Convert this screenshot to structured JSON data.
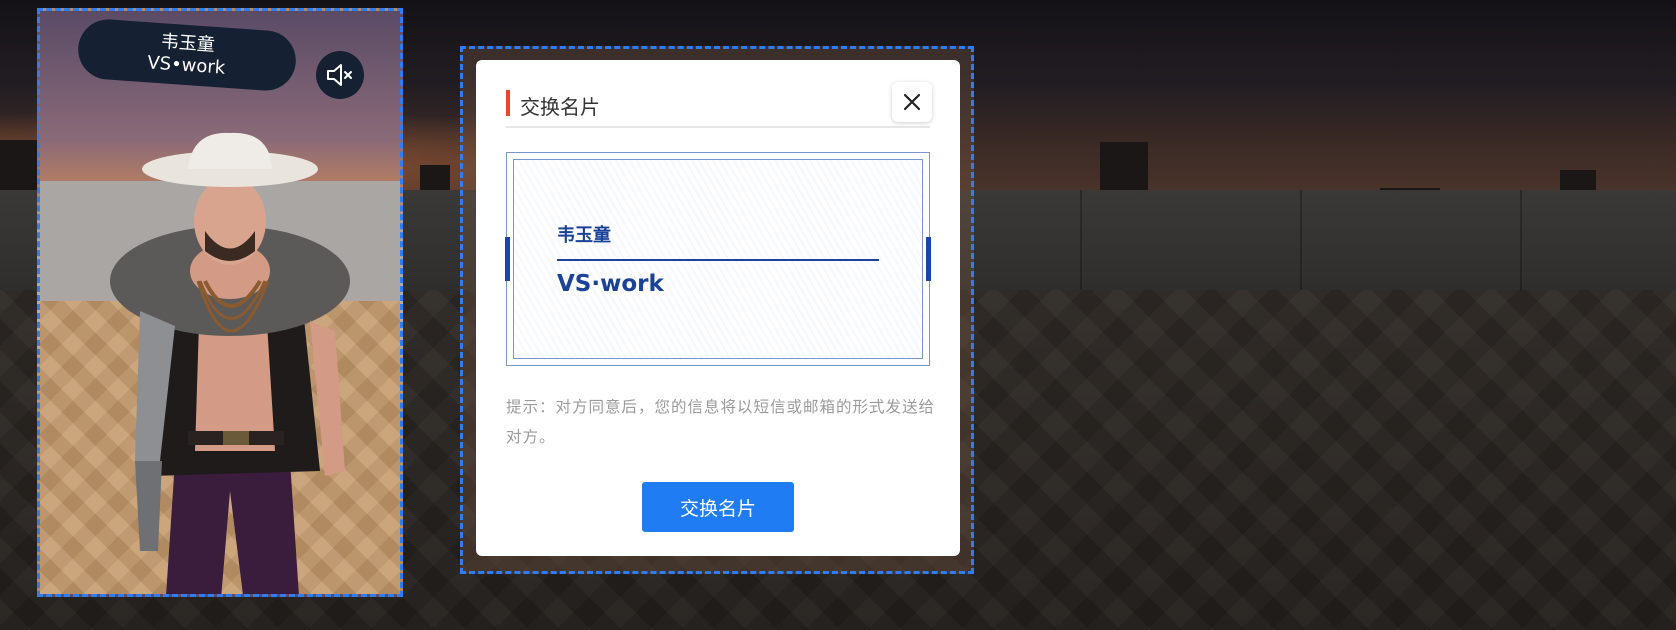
{
  "avatar": {
    "name": "韦玉童",
    "company": "VS•work",
    "mute_icon": "speaker-muted-icon"
  },
  "dialog": {
    "title": "交换名片",
    "close_icon": "close-icon",
    "card": {
      "name": "韦玉童",
      "company": "VS·work"
    },
    "hint": "提示：对方同意后，您的信息将以短信或邮箱的形式发送给对方。",
    "confirm_label": "交换名片"
  },
  "colors": {
    "accent_blue": "#1f7cf3",
    "card_blue": "#1a4299",
    "title_accent": "#f0432b",
    "selection_dash": "#2f7df6"
  }
}
